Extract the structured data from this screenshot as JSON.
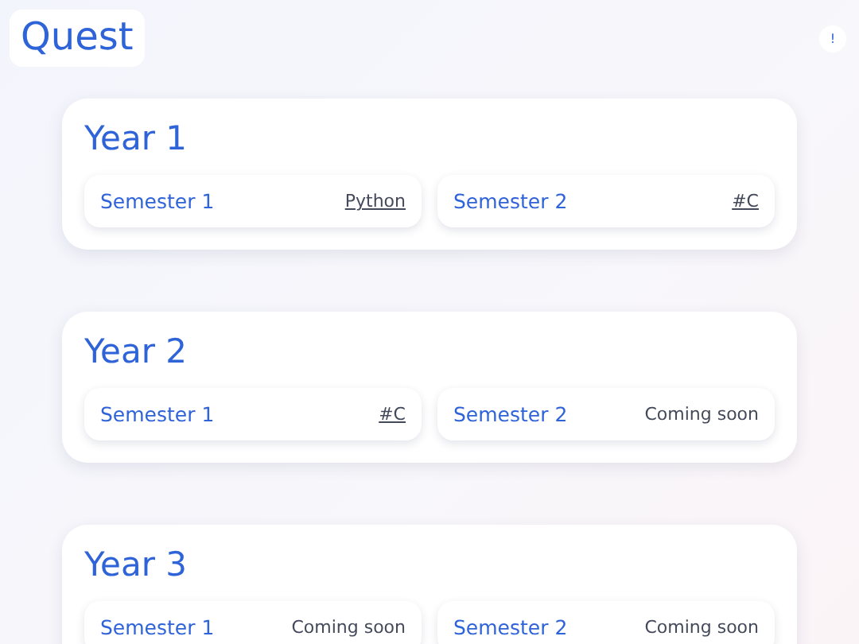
{
  "brand": {
    "title": "Quest"
  },
  "info_button": {
    "label": "!"
  },
  "years": [
    {
      "title": "Year 1",
      "semesters": [
        {
          "label": "Semester 1",
          "tag": "Python",
          "kind": "link"
        },
        {
          "label": "Semester 2",
          "tag": "#C",
          "kind": "link"
        }
      ]
    },
    {
      "title": "Year 2",
      "semesters": [
        {
          "label": "Semester 1",
          "tag": "#C",
          "kind": "link"
        },
        {
          "label": "Semester 2",
          "tag": "Coming soon",
          "kind": "status"
        }
      ]
    },
    {
      "title": "Year 3",
      "semesters": [
        {
          "label": "Semester 1",
          "tag": "Coming soon",
          "kind": "status"
        },
        {
          "label": "Semester 2",
          "tag": "Coming soon",
          "kind": "status"
        }
      ]
    }
  ]
}
